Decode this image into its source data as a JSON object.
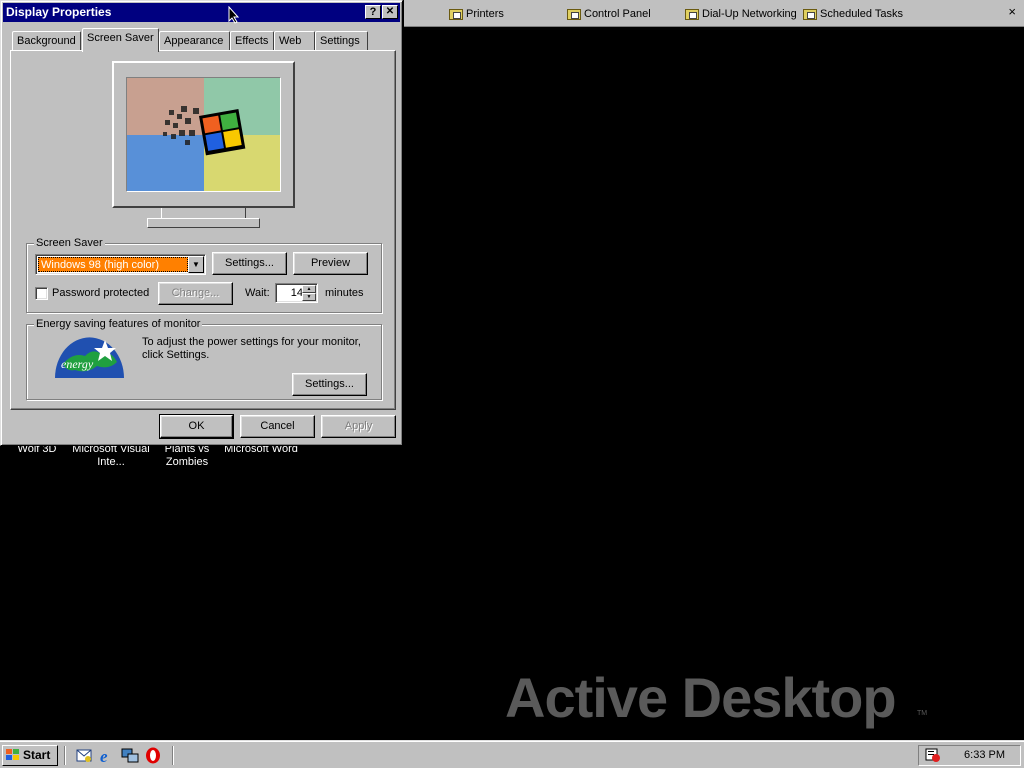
{
  "dialog": {
    "title": "Display Properties",
    "help_btn": "?",
    "close_btn": "✕",
    "tabs": [
      "Background",
      "Screen Saver",
      "Appearance",
      "Effects",
      "Web",
      "Settings"
    ],
    "active_tab": "Screen Saver",
    "screen_saver": {
      "group_label": "Screen Saver",
      "selected": "Windows 98 (high color)",
      "settings_btn": "Settings...",
      "preview_btn": "Preview",
      "password_label": "Password protected",
      "password_checked": false,
      "change_btn": "Change...",
      "wait_label": "Wait:",
      "wait_value": "14",
      "minutes_label": "minutes"
    },
    "energy": {
      "group_label": "Energy saving features of monitor",
      "description": "To adjust the power settings for your monitor, click Settings.",
      "settings_btn": "Settings..."
    },
    "footer": {
      "ok": "OK",
      "cancel": "Cancel",
      "apply": "Apply"
    }
  },
  "linkbar": {
    "items": [
      "Printers",
      "Control Panel",
      "Dial-Up Networking",
      "Scheduled Tasks"
    ],
    "close": "×"
  },
  "desktop": {
    "icons": [
      {
        "label": "Wolf 3D"
      },
      {
        "label": "Microsoft Visual Inte..."
      },
      {
        "label": "Plants vs Zombies"
      },
      {
        "label": "Microsoft Word"
      }
    ],
    "watermark": "Active Desktop",
    "watermark_tm": "TM"
  },
  "taskbar": {
    "start_label": "Start",
    "quick_launch": [
      "outlook-express-icon",
      "internet-explorer-icon",
      "network-icon",
      "opera-icon"
    ],
    "clock": "6:33 PM"
  },
  "colors": {
    "titlebar": "#000080",
    "selection": "#ff8000",
    "face": "#c0c0c0"
  }
}
